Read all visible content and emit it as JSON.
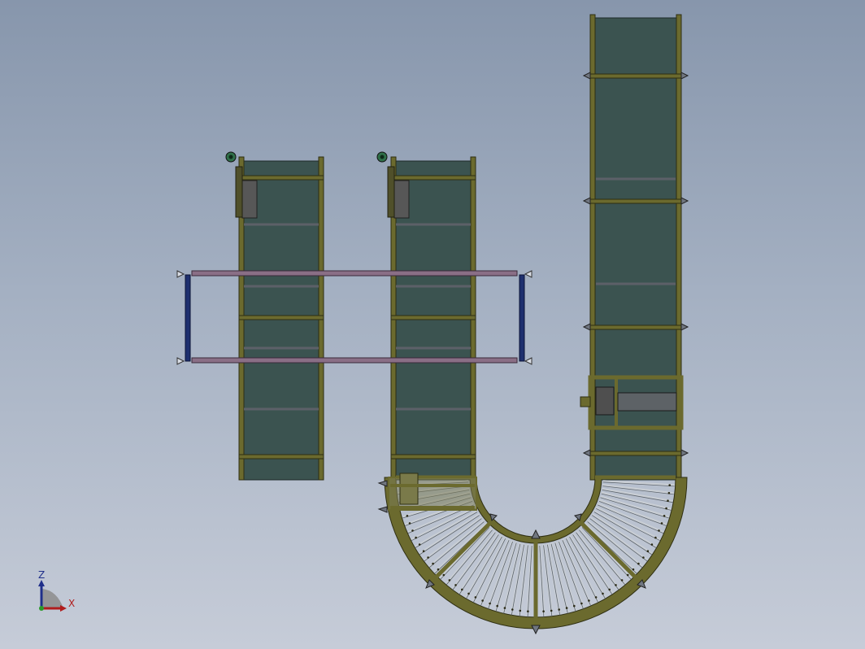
{
  "view": {
    "background_top": "#8796ac",
    "background_bottom": "#c6ccd8"
  },
  "model": {
    "frame_color": "#6b6a2e",
    "frame_edge": "#2e2e12",
    "belt_color": "#3b5350",
    "roller_color": "#9aa3ad",
    "strut_color": "#1e2f6e",
    "rod_color": "#8a6f86",
    "motor_color": "#2f6e48"
  },
  "triad": {
    "z_label": "Z",
    "x_label": "X",
    "z_color": "#1f2f8a",
    "x_color": "#b01c1c"
  }
}
